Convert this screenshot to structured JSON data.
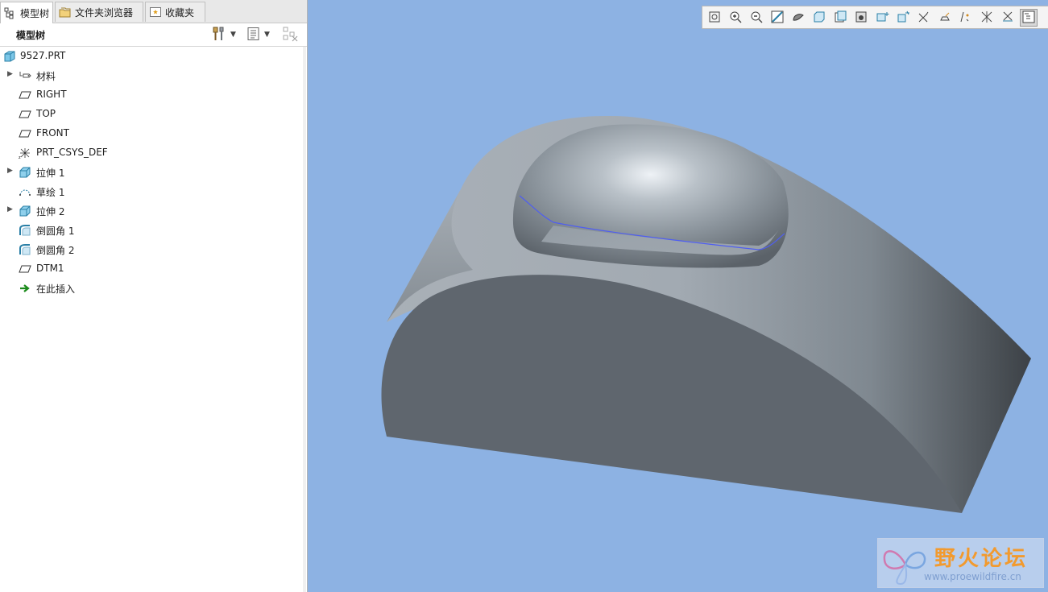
{
  "tabs": [
    {
      "label": "模型树",
      "icon": "model-tree-icon",
      "active": true
    },
    {
      "label": "文件夹浏览器",
      "icon": "folder-browser-icon",
      "active": false
    },
    {
      "label": "收藏夹",
      "icon": "favorites-icon",
      "active": false
    }
  ],
  "panel": {
    "title": "模型树"
  },
  "tree": {
    "root": {
      "label": "9527.PRT",
      "icon": "part-icon"
    },
    "items": [
      {
        "label": "材料",
        "icon": "material-icon",
        "expandable": true
      },
      {
        "label": "RIGHT",
        "icon": "datum-plane-icon",
        "expandable": false
      },
      {
        "label": "TOP",
        "icon": "datum-plane-icon",
        "expandable": false
      },
      {
        "label": "FRONT",
        "icon": "datum-plane-icon",
        "expandable": false
      },
      {
        "label": "PRT_CSYS_DEF",
        "icon": "csys-icon",
        "expandable": false
      },
      {
        "label": "拉伸 1",
        "icon": "extrude-icon",
        "expandable": true
      },
      {
        "label": "草绘 1",
        "icon": "sketch-icon",
        "expandable": false
      },
      {
        "label": "拉伸 2",
        "icon": "extrude-icon",
        "expandable": true
      },
      {
        "label": "倒圆角 1",
        "icon": "round-icon",
        "expandable": false
      },
      {
        "label": "倒圆角 2",
        "icon": "round-icon",
        "expandable": false
      },
      {
        "label": "DTM1",
        "icon": "datum-plane-icon",
        "expandable": false
      },
      {
        "label": "在此插入",
        "icon": "insert-here-icon",
        "expandable": false
      }
    ]
  },
  "graphics_toolbar": [
    "refit-icon",
    "zoom-in-icon",
    "zoom-out-icon",
    "repaint-icon",
    "display-style-icon",
    "saved-orientations-icon",
    "view-manager-icon",
    "perspective-icon",
    "spin-center-icon",
    "annotation-display-icon",
    "plane-display-icon",
    "axis-display-icon",
    "point-display-icon",
    "csys-display-icon",
    "show-all-icon",
    "model-tree-toggle-icon"
  ],
  "watermark": {
    "title": "野火论坛",
    "url": "www.proewildfire.cn"
  },
  "colors": {
    "viewport_bg": "#8db2e3",
    "model_face": "#5f666e",
    "model_top": "#9aa3ab",
    "edge_highlight": "#4f5ef0"
  }
}
